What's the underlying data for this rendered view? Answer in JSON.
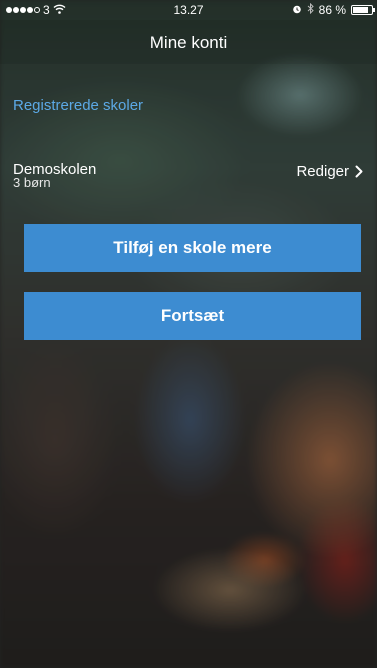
{
  "status_bar": {
    "carrier": "3",
    "time": "13.27",
    "battery_text": "86 %",
    "battery_level": 0.86
  },
  "nav": {
    "title": "Mine konti"
  },
  "section": {
    "header": "Registrerede skoler"
  },
  "schools": [
    {
      "name": "Demoskolen",
      "children": "3 børn",
      "action_label": "Rediger"
    }
  ],
  "actions": {
    "add_school_label": "Tilføj en skole mere",
    "continue_label": "Fortsæt"
  },
  "colors": {
    "accent_text": "#5ca9e6",
    "button_bg": "#3d8cd1",
    "text": "#ffffff"
  },
  "icons": {
    "wifi": "wifi-icon",
    "alarm": "alarm-icon",
    "bluetooth": "bluetooth-icon",
    "chevron": "chevron-right-icon"
  }
}
